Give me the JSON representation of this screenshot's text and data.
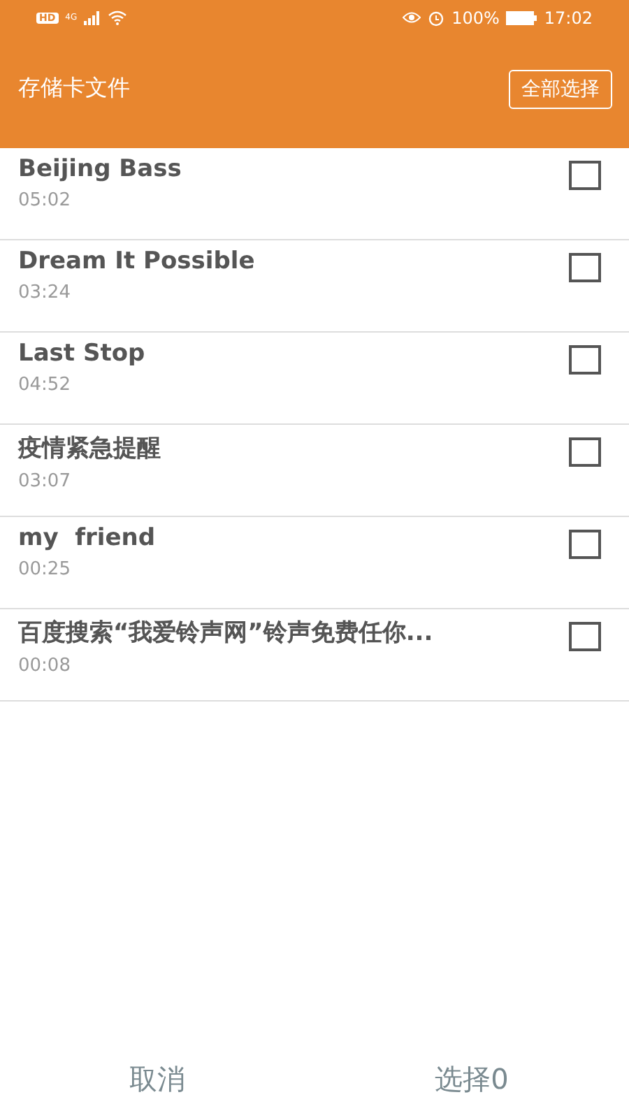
{
  "status_bar": {
    "hd": "HD",
    "network": "4G",
    "battery": "100%",
    "time": "17:02"
  },
  "header": {
    "title": "存储卡文件",
    "select_all": "全部选择"
  },
  "files": [
    {
      "name": "Beijing Bass",
      "duration": "05:02",
      "checked": false
    },
    {
      "name": "Dream It Possible",
      "duration": "03:24",
      "checked": false
    },
    {
      "name": "Last Stop",
      "duration": "04:52",
      "checked": false
    },
    {
      "name": "疫情紧急提醒",
      "duration": "03:07",
      "checked": false
    },
    {
      "name": "my  friend",
      "duration": "00:25",
      "checked": false
    },
    {
      "name": "百度搜索“我爱铃声网”铃声免费任你...",
      "duration": "00:08",
      "checked": false
    }
  ],
  "footer": {
    "cancel": "取消",
    "confirm": "选择0"
  }
}
